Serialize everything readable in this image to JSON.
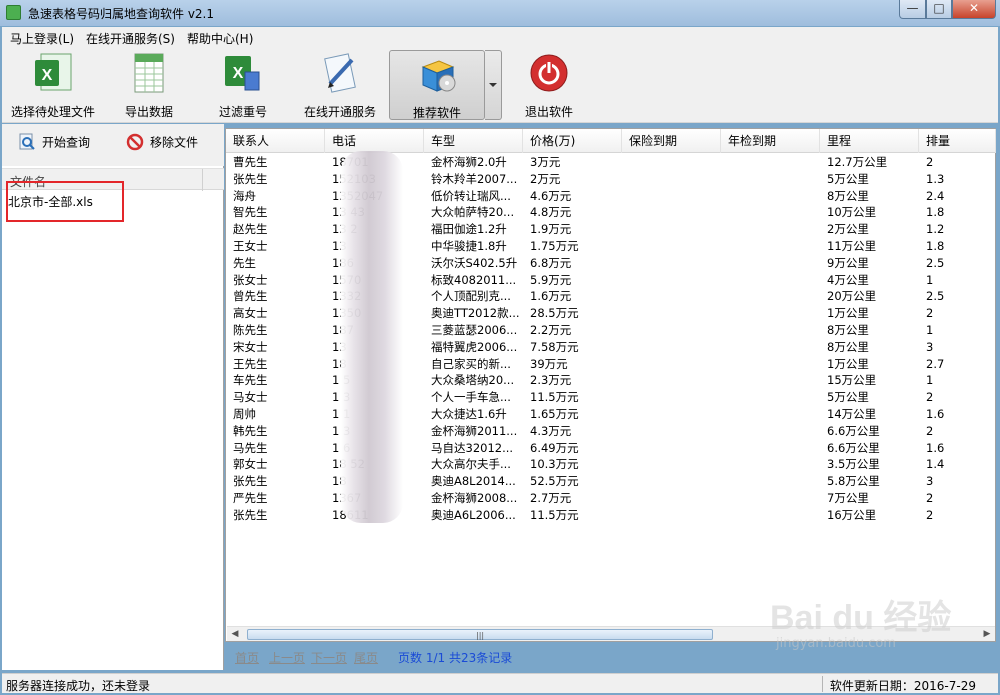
{
  "window": {
    "title": "急速表格号码归属地查询软件 v2.1",
    "minimize": "—",
    "maximize": "□",
    "close": "✕"
  },
  "menu": [
    "马上登录(L)",
    "在线开通服务(S)",
    "帮助中心(H)"
  ],
  "toolbar": {
    "select_file": "选择待处理文件",
    "export": "导出数据",
    "filter_dup": "过滤重号",
    "online_service": "在线开通服务",
    "recommend": "推荐软件",
    "exit": "退出软件"
  },
  "left": {
    "start_query": "开始查询",
    "remove_file": "移除文件",
    "file_header": "文件名",
    "files": [
      "北京市-全部.xls"
    ]
  },
  "grid": {
    "columns": [
      "联系人",
      "电话",
      "车型",
      "价格(万)",
      "保险到期",
      "年检到期",
      "里程",
      "排量"
    ],
    "rows": [
      [
        "曹先生",
        "18701",
        "金杯海狮2.0升",
        "3万元",
        "",
        "",
        "12.7万公里",
        "2"
      ],
      [
        "张先生",
        "152103",
        "铃木羚羊2007...",
        "2万元",
        "",
        "",
        "5万公里",
        "1.3"
      ],
      [
        "海舟",
        "1352047",
        "低价转让瑞风...",
        "4.6万元",
        "",
        "",
        "8万公里",
        "2.4"
      ],
      [
        "智先生",
        "13   43",
        "大众帕萨特20...",
        "4.8万元",
        "",
        "",
        "10万公里",
        "1.8"
      ],
      [
        "赵先生",
        "13   2",
        "福田伽途1.2升",
        "1.9万元",
        "",
        "",
        "2万公里",
        "1.2"
      ],
      [
        "王女士",
        "13",
        "中华骏捷1.8升",
        "1.75万元",
        "",
        "",
        "11万公里",
        "1.8"
      ],
      [
        "先生",
        "186",
        "沃尔沃S402.5升",
        "6.8万元",
        "",
        "",
        "9万公里",
        "2.5"
      ],
      [
        "张女士",
        "1570",
        "标致4082011...",
        "5.9万元",
        "",
        "",
        "4万公里",
        "1"
      ],
      [
        "曾先生",
        "1332",
        "个人顶配别克...",
        "1.6万元",
        "",
        "",
        "20万公里",
        "2.5"
      ],
      [
        "高女士",
        "1350",
        "奥迪TT2012款...",
        "28.5万元",
        "",
        "",
        "1万公里",
        "2"
      ],
      [
        "陈先生",
        "187",
        "三菱蓝瑟2006...",
        "2.2万元",
        "",
        "",
        "8万公里",
        "1"
      ],
      [
        "宋女士",
        "13",
        "福特翼虎2006...",
        "7.58万元",
        "",
        "",
        "8万公里",
        "3"
      ],
      [
        "王先生",
        "18",
        "自己家买的新...",
        "39万元",
        "",
        "",
        "1万公里",
        "2.7"
      ],
      [
        "车先生",
        "1   5",
        "大众桑塔纳20...",
        "2.3万元",
        "",
        "",
        "15万公里",
        "1"
      ],
      [
        "马女士",
        "1   3",
        "个人一手车急...",
        "11.5万元",
        "",
        "",
        "5万公里",
        "2"
      ],
      [
        "周帅",
        "1   1",
        "大众捷达1.6升",
        "1.65万元",
        "",
        "",
        "14万公里",
        "1.6"
      ],
      [
        "韩先生",
        "1   3",
        "金杯海狮2011...",
        "4.3万元",
        "",
        "",
        "6.6万公里",
        "2"
      ],
      [
        "马先生",
        "1   6",
        "马自达32012...",
        "6.49万元",
        "",
        "",
        "6.6万公里",
        "1.6"
      ],
      [
        "郭女士",
        "18   52",
        "大众高尔夫手...",
        "10.3万元",
        "",
        "",
        "3.5万公里",
        "1.4"
      ],
      [
        "张先生",
        "18",
        "奥迪A8L2014...",
        "52.5万元",
        "",
        "",
        "5.8万公里",
        "3"
      ],
      [
        "严先生",
        "1367",
        "金杯海狮2008...",
        "2.7万元",
        "",
        "",
        "7万公里",
        "2"
      ],
      [
        "张先生",
        "18611",
        "奥迪A6L2006...",
        "11.5万元",
        "",
        "",
        "16万公里",
        "2"
      ]
    ]
  },
  "pager": {
    "first": "首页",
    "prev": "上一页",
    "next": "下一页",
    "last": "尾页",
    "info": "页数 1/1 共23条记录"
  },
  "status": {
    "left": "服务器连接成功，还未登录",
    "right": "软件更新日期：2016-7-29"
  },
  "watermark": {
    "logo": "Bai du 经验",
    "url": "jingyan.baidu.com"
  },
  "colors": {
    "highlight_box": "#e3262a",
    "pager_info": "#1a4bd6",
    "exit_icon": "#d32f2f"
  }
}
